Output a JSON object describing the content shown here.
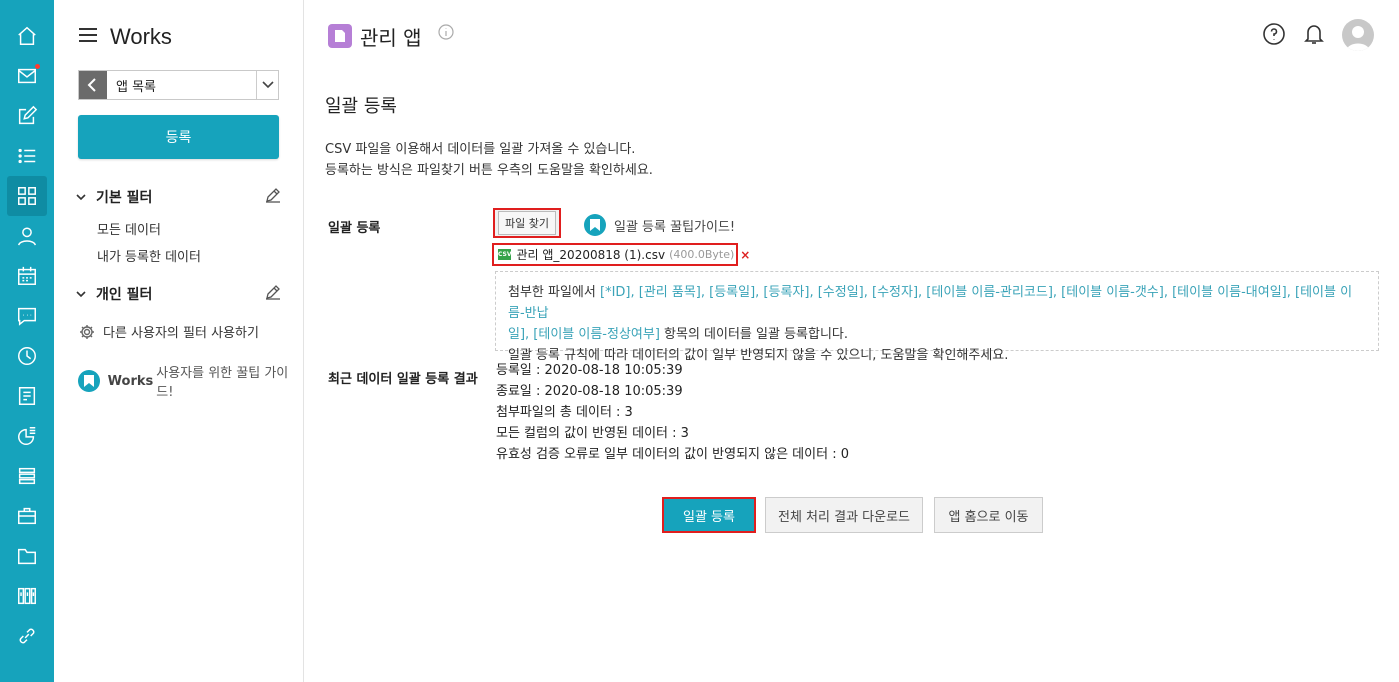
{
  "rail": {
    "items": [
      {
        "name": "home-icon",
        "icon": "home"
      },
      {
        "name": "mail-icon",
        "icon": "mail",
        "has_dot": true
      },
      {
        "name": "write-icon",
        "icon": "edit"
      },
      {
        "name": "task-list-icon",
        "icon": "list"
      },
      {
        "name": "apps-grid-icon",
        "icon": "grid",
        "active": true
      },
      {
        "name": "person-icon",
        "icon": "person"
      },
      {
        "name": "calendar-icon",
        "icon": "calendar"
      },
      {
        "name": "chat-icon",
        "icon": "chat"
      },
      {
        "name": "clock-icon",
        "icon": "clock"
      },
      {
        "name": "board-icon",
        "icon": "board"
      },
      {
        "name": "stats-icon",
        "icon": "stats"
      },
      {
        "name": "stack-icon",
        "icon": "stack"
      },
      {
        "name": "briefcase-icon",
        "icon": "briefcase"
      },
      {
        "name": "folder-icon",
        "icon": "folder"
      },
      {
        "name": "library-icon",
        "icon": "library"
      },
      {
        "name": "link-icon",
        "icon": "link"
      }
    ]
  },
  "sidebar": {
    "brand": "Works",
    "app_select_label": "앱 목록",
    "register_label": "등록",
    "basic_filter": {
      "title": "기본 필터",
      "items": [
        "모든 데이터",
        "내가 등록한 데이터"
      ]
    },
    "personal_filter": {
      "title": "개인 필터"
    },
    "other_filter_label": "다른 사용자의 필터 사용하기",
    "tip_brand": "Works",
    "tip_label": "사용자를 위한 꿀팁 가이드!"
  },
  "header": {
    "title": "관리 앱"
  },
  "page": {
    "section_title": "일괄 등록",
    "desc_line1": "CSV 파일을 이용해서 데이터를 일괄 가져올 수 있습니다.",
    "desc_line2": "등록하는 방식은 파일찾기 버튼 우측의 도움말을 확인하세요.",
    "bulk_label": "일괄 등록",
    "file_button": "파일 찾기",
    "guide_link": "일괄 등록 꿀팁가이드!",
    "file": {
      "name": "관리 앱_20200818 (1).csv",
      "size": "(400.0Byte)",
      "remove": "×",
      "icon_text": "CSV"
    },
    "notice": {
      "prefix": "첨부한 파일에서 ",
      "columns_line1": "[*ID], [관리 품목], [등록일], [등록자], [수정일], [수정자], [테이블 이름-관리코드], [테이블 이름-갯수], [테이블 이름-대여일], [테이블 이름-반납",
      "columns_line2": "일], [테이블 이름-정상여부]",
      "suffix": " 항목의 데이터를 일괄 등록합니다.",
      "line3": "일괄 등록 규칙에 따라 데이터의 값이 일부 반영되지 않을 수 있으니, 도움말을 확인해주세요."
    },
    "result_label": "최근 데이터 일괄 등록 결과",
    "result_lines": [
      "등록일 : 2020-08-18 10:05:39",
      "종료일 : 2020-08-18 10:05:39",
      "첨부파일의 총 데이터 : 3",
      "모든 컬럼의 값이 반영된 데이터 : 3",
      "유효성 검증 오류로 일부 데이터의 값이 반영되지 않은 데이터 : 0"
    ],
    "buttons": {
      "bulk_register": "일괄 등록",
      "download_results": "전체 처리 결과 다운로드",
      "go_app_home": "앱 홈으로 이동"
    }
  },
  "colors": {
    "accent": "#16a3bc",
    "highlight_border": "#e01e1e",
    "app_badge": "#b67fd6"
  }
}
